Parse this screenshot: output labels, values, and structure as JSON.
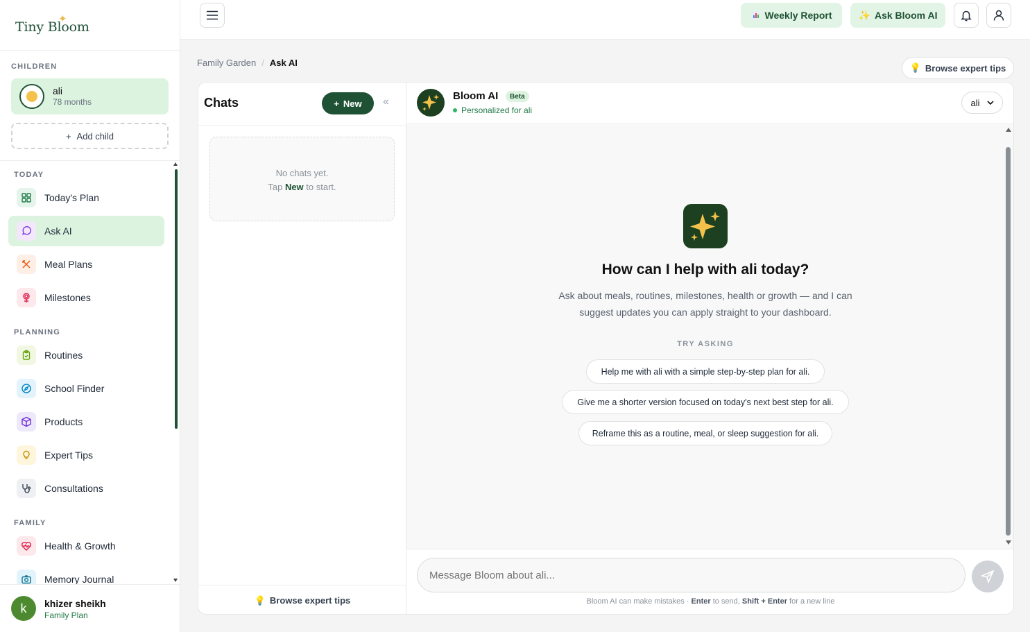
{
  "app": {
    "name": "Tiny Bloom"
  },
  "sidebar": {
    "children_label": "CHILDREN",
    "child": {
      "name": "ali",
      "age": "78 months"
    },
    "add_child": "Add child",
    "sections": [
      {
        "label": "TODAY",
        "items": [
          {
            "label": "Today's Plan",
            "icon": "grid-icon"
          },
          {
            "label": "Ask AI",
            "icon": "chat-bubble-icon",
            "active": true
          },
          {
            "label": "Meal Plans",
            "icon": "utensils-icon"
          },
          {
            "label": "Milestones",
            "icon": "flower-icon"
          }
        ]
      },
      {
        "label": "PLANNING",
        "items": [
          {
            "label": "Routines",
            "icon": "clipboard-check-icon"
          },
          {
            "label": "School Finder",
            "icon": "compass-icon"
          },
          {
            "label": "Products",
            "icon": "box-icon"
          },
          {
            "label": "Expert Tips",
            "icon": "lightbulb-icon"
          },
          {
            "label": "Consultations",
            "icon": "stethoscope-icon"
          }
        ]
      },
      {
        "label": "FAMILY",
        "items": [
          {
            "label": "Health & Growth",
            "icon": "heart-pulse-icon"
          },
          {
            "label": "Memory Journal",
            "icon": "camera-icon"
          }
        ]
      }
    ],
    "user": {
      "initial": "k",
      "name": "khizer sheikh",
      "plan": "Family Plan"
    }
  },
  "topbar": {
    "weekly_report": "Weekly Report",
    "ask_bloom": "Ask Bloom AI"
  },
  "breadcrumb": {
    "parent": "Family Garden",
    "separator": "/",
    "current": "Ask AI"
  },
  "browse_tips": "Browse expert tips",
  "chats": {
    "title": "Chats",
    "new_label": "New",
    "empty_line1": "No chats yet.",
    "empty_tap": "Tap",
    "empty_new": "New",
    "empty_rest": "to start.",
    "footer": "Browse expert tips"
  },
  "assistant": {
    "name": "Bloom AI",
    "badge": "Beta",
    "status": "Personalized for ali",
    "selected_child": "ali"
  },
  "hero": {
    "title": "How can I help with ali today?",
    "subtitle": "Ask about meals, routines, milestones, health or growth — and I can suggest updates you can apply straight to your dashboard.",
    "try_label": "TRY ASKING",
    "suggestions": [
      "Help me with ali with a simple step-by-step plan for ali.",
      "Give me a shorter version focused on today's next best step for ali.",
      "Reframe this as a routine, meal, or sleep suggestion for ali."
    ]
  },
  "composer": {
    "placeholder": "Message Bloom about ali...",
    "disclaimer_prefix": "Bloom AI can make mistakes · ",
    "enter": "Enter",
    "to_send": " to send, ",
    "shift_enter": "Shift + Enter",
    "new_line": " for a new line"
  },
  "colors": {
    "brand": "#1f5134",
    "accent": "#dcf3e0",
    "gold": "#f4c24a"
  }
}
